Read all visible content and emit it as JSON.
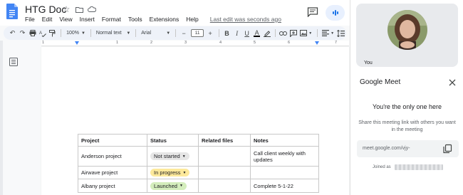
{
  "doc": {
    "title": "HTG Doc",
    "menu": [
      "File",
      "Edit",
      "View",
      "Insert",
      "Format",
      "Tools",
      "Extensions",
      "Help"
    ],
    "last_edit": "Last edit was seconds ago"
  },
  "toolbar": {
    "zoom": "100%",
    "style": "Normal text",
    "font": "Arial",
    "font_size": "11",
    "minus": "−",
    "plus": "+"
  },
  "ruler": {
    "numbers": [
      "1",
      "1",
      "2",
      "3",
      "4",
      "5",
      "6",
      "7"
    ]
  },
  "table": {
    "headers": [
      "Project",
      "Status",
      "Related files",
      "Notes"
    ],
    "rows": [
      {
        "project": "Anderson project",
        "status": "Not started",
        "files": "",
        "notes": "Call client weekly with updates"
      },
      {
        "project": "Airwave project",
        "status": "In progress",
        "files": "",
        "notes": ""
      },
      {
        "project": "Albany project",
        "status": "Launched",
        "files": "",
        "notes": "Complete 5-1-22"
      }
    ],
    "status_colors": {
      "not_started": "#e6e6e6",
      "in_progress": "#fde99b",
      "launched": "#d4edbc"
    }
  },
  "meet": {
    "tile_label": "You",
    "title": "Google Meet",
    "only_one": "You're the only one here",
    "share_text": "Share this meeting link with others you want in the meeting",
    "link": "meet.google.com/vjy-",
    "joined_as": "Joined as"
  },
  "colors": {
    "accent": "#1a73e8",
    "docs_blue": "#4285f4",
    "toolbar_bg": "#eef2f9",
    "meet_pill": "#e8f0fe"
  }
}
